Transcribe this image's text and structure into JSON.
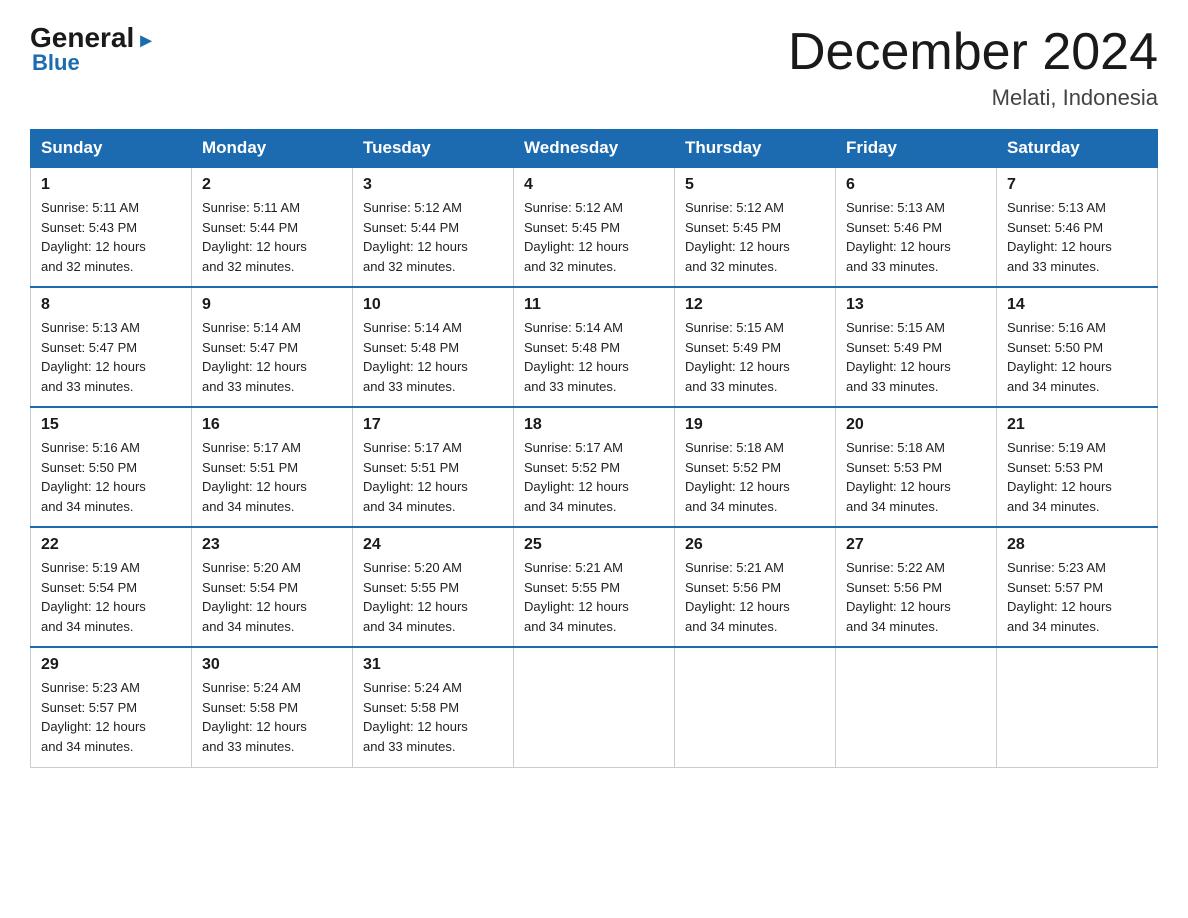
{
  "logo": {
    "general": "General",
    "arrow": "▶",
    "blue": "Blue"
  },
  "header": {
    "month": "December 2024",
    "location": "Melati, Indonesia"
  },
  "days_of_week": [
    "Sunday",
    "Monday",
    "Tuesday",
    "Wednesday",
    "Thursday",
    "Friday",
    "Saturday"
  ],
  "weeks": [
    [
      {
        "day": "1",
        "sunrise": "5:11 AM",
        "sunset": "5:43 PM",
        "daylight": "12 hours and 32 minutes."
      },
      {
        "day": "2",
        "sunrise": "5:11 AM",
        "sunset": "5:44 PM",
        "daylight": "12 hours and 32 minutes."
      },
      {
        "day": "3",
        "sunrise": "5:12 AM",
        "sunset": "5:44 PM",
        "daylight": "12 hours and 32 minutes."
      },
      {
        "day": "4",
        "sunrise": "5:12 AM",
        "sunset": "5:45 PM",
        "daylight": "12 hours and 32 minutes."
      },
      {
        "day": "5",
        "sunrise": "5:12 AM",
        "sunset": "5:45 PM",
        "daylight": "12 hours and 32 minutes."
      },
      {
        "day": "6",
        "sunrise": "5:13 AM",
        "sunset": "5:46 PM",
        "daylight": "12 hours and 33 minutes."
      },
      {
        "day": "7",
        "sunrise": "5:13 AM",
        "sunset": "5:46 PM",
        "daylight": "12 hours and 33 minutes."
      }
    ],
    [
      {
        "day": "8",
        "sunrise": "5:13 AM",
        "sunset": "5:47 PM",
        "daylight": "12 hours and 33 minutes."
      },
      {
        "day": "9",
        "sunrise": "5:14 AM",
        "sunset": "5:47 PM",
        "daylight": "12 hours and 33 minutes."
      },
      {
        "day": "10",
        "sunrise": "5:14 AM",
        "sunset": "5:48 PM",
        "daylight": "12 hours and 33 minutes."
      },
      {
        "day": "11",
        "sunrise": "5:14 AM",
        "sunset": "5:48 PM",
        "daylight": "12 hours and 33 minutes."
      },
      {
        "day": "12",
        "sunrise": "5:15 AM",
        "sunset": "5:49 PM",
        "daylight": "12 hours and 33 minutes."
      },
      {
        "day": "13",
        "sunrise": "5:15 AM",
        "sunset": "5:49 PM",
        "daylight": "12 hours and 33 minutes."
      },
      {
        "day": "14",
        "sunrise": "5:16 AM",
        "sunset": "5:50 PM",
        "daylight": "12 hours and 34 minutes."
      }
    ],
    [
      {
        "day": "15",
        "sunrise": "5:16 AM",
        "sunset": "5:50 PM",
        "daylight": "12 hours and 34 minutes."
      },
      {
        "day": "16",
        "sunrise": "5:17 AM",
        "sunset": "5:51 PM",
        "daylight": "12 hours and 34 minutes."
      },
      {
        "day": "17",
        "sunrise": "5:17 AM",
        "sunset": "5:51 PM",
        "daylight": "12 hours and 34 minutes."
      },
      {
        "day": "18",
        "sunrise": "5:17 AM",
        "sunset": "5:52 PM",
        "daylight": "12 hours and 34 minutes."
      },
      {
        "day": "19",
        "sunrise": "5:18 AM",
        "sunset": "5:52 PM",
        "daylight": "12 hours and 34 minutes."
      },
      {
        "day": "20",
        "sunrise": "5:18 AM",
        "sunset": "5:53 PM",
        "daylight": "12 hours and 34 minutes."
      },
      {
        "day": "21",
        "sunrise": "5:19 AM",
        "sunset": "5:53 PM",
        "daylight": "12 hours and 34 minutes."
      }
    ],
    [
      {
        "day": "22",
        "sunrise": "5:19 AM",
        "sunset": "5:54 PM",
        "daylight": "12 hours and 34 minutes."
      },
      {
        "day": "23",
        "sunrise": "5:20 AM",
        "sunset": "5:54 PM",
        "daylight": "12 hours and 34 minutes."
      },
      {
        "day": "24",
        "sunrise": "5:20 AM",
        "sunset": "5:55 PM",
        "daylight": "12 hours and 34 minutes."
      },
      {
        "day": "25",
        "sunrise": "5:21 AM",
        "sunset": "5:55 PM",
        "daylight": "12 hours and 34 minutes."
      },
      {
        "day": "26",
        "sunrise": "5:21 AM",
        "sunset": "5:56 PM",
        "daylight": "12 hours and 34 minutes."
      },
      {
        "day": "27",
        "sunrise": "5:22 AM",
        "sunset": "5:56 PM",
        "daylight": "12 hours and 34 minutes."
      },
      {
        "day": "28",
        "sunrise": "5:23 AM",
        "sunset": "5:57 PM",
        "daylight": "12 hours and 34 minutes."
      }
    ],
    [
      {
        "day": "29",
        "sunrise": "5:23 AM",
        "sunset": "5:57 PM",
        "daylight": "12 hours and 34 minutes."
      },
      {
        "day": "30",
        "sunrise": "5:24 AM",
        "sunset": "5:58 PM",
        "daylight": "12 hours and 33 minutes."
      },
      {
        "day": "31",
        "sunrise": "5:24 AM",
        "sunset": "5:58 PM",
        "daylight": "12 hours and 33 minutes."
      },
      null,
      null,
      null,
      null
    ]
  ],
  "labels": {
    "sunrise": "Sunrise:",
    "sunset": "Sunset:",
    "daylight": "Daylight:"
  }
}
